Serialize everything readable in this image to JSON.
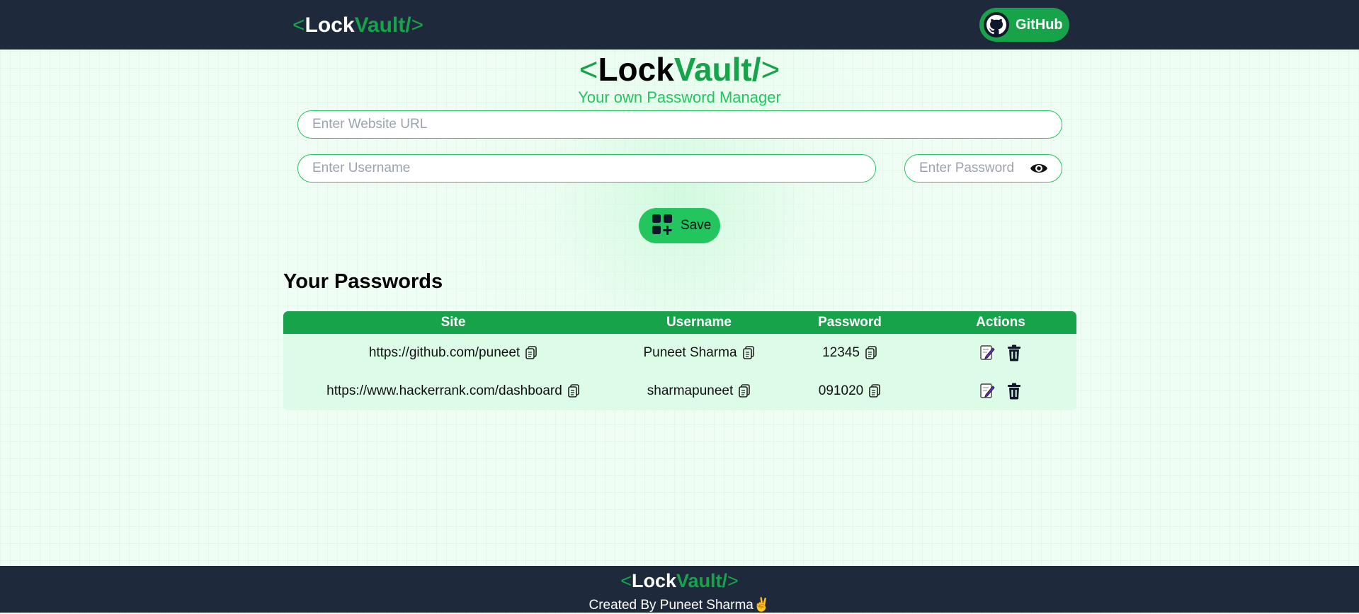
{
  "brand": {
    "open": "<",
    "part1": "Lock",
    "part2": "Vault/",
    "close": ">"
  },
  "navbar": {
    "github_label": "GitHub"
  },
  "hero": {
    "subtitle": "Your own Password Manager"
  },
  "form": {
    "url_placeholder": "Enter Website URL",
    "username_placeholder": "Enter Username",
    "password_placeholder": "Enter Password",
    "url_value": "",
    "username_value": "",
    "password_value": "",
    "save_label": "Save"
  },
  "passwords": {
    "title": "Your Passwords",
    "columns": [
      "Site",
      "Username",
      "Password",
      "Actions"
    ],
    "rows": [
      {
        "site": "https://github.com/puneet",
        "username": "Puneet Sharma",
        "password": "12345"
      },
      {
        "site": "https://www.hackerrank.com/dashboard",
        "username": "sharmapuneet",
        "password": "091020"
      }
    ]
  },
  "footer": {
    "credit": "Created By Puneet Sharma",
    "emoji": "✌️"
  },
  "icons": {
    "github": "github-icon",
    "eye": "eye-icon",
    "save": "add-square-icon",
    "copy": "copy-icon",
    "edit": "edit-icon",
    "delete": "trash-icon"
  },
  "colors": {
    "accent": "#22c55e",
    "accent_dark": "#16a34a",
    "nav_bg": "#1e293b",
    "row_bg": "#dcfce7"
  }
}
